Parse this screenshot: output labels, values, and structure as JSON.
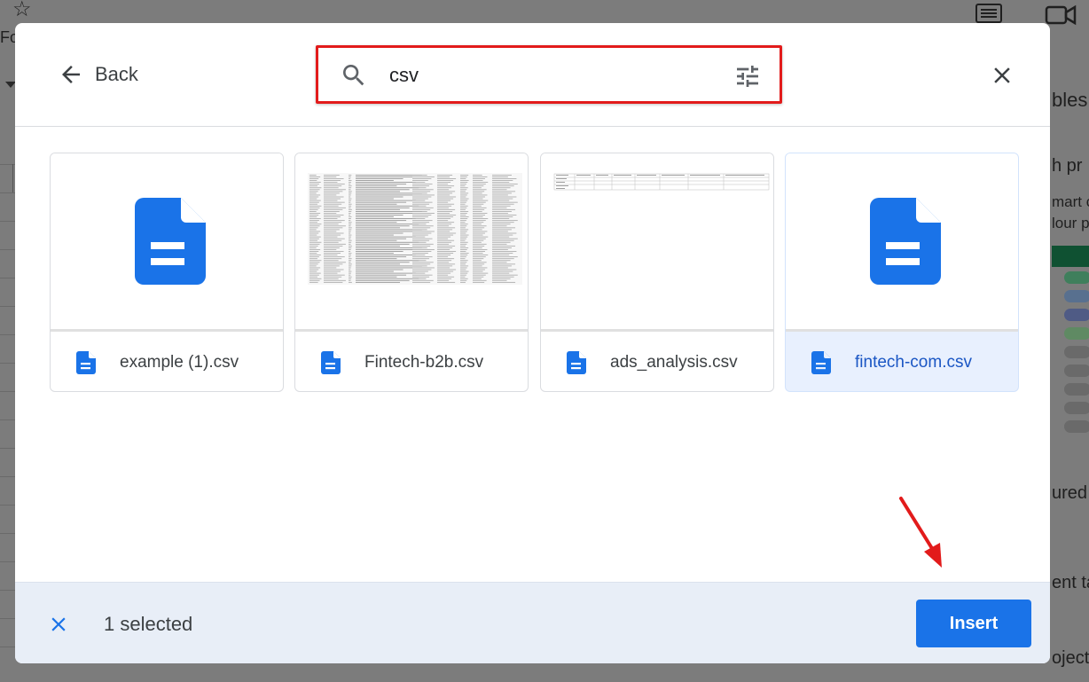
{
  "background": {
    "truncated_text": [
      "Fo",
      "bles",
      "h pr",
      "mart c",
      "lour p",
      "ured",
      "ent ta",
      "oject"
    ]
  },
  "header": {
    "back_label": "Back",
    "search_value": "csv"
  },
  "files": [
    {
      "name": "example (1).csv",
      "thumbnail": "doc-icon",
      "selected": false
    },
    {
      "name": "Fintech-b2b.csv",
      "thumbnail": "spreadsheet-preview",
      "selected": false
    },
    {
      "name": "ads_analysis.csv",
      "thumbnail": "table-preview",
      "selected": false
    },
    {
      "name": "fintech-com.csv",
      "thumbnail": "doc-icon",
      "selected": true
    }
  ],
  "footer": {
    "selected_text": "1 selected",
    "insert_label": "Insert"
  },
  "colors": {
    "accent": "#1a73e8",
    "highlight_box": "#e21b1b",
    "selected_card": "#e8f0fe",
    "footer_bg": "#e8eef7"
  }
}
